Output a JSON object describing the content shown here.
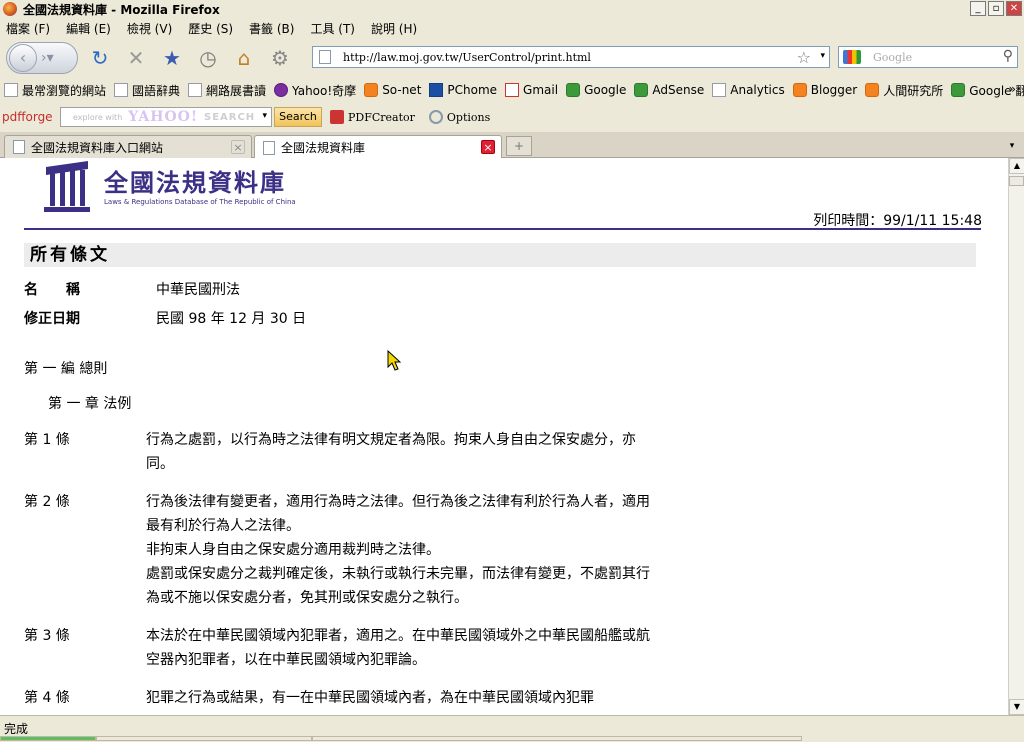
{
  "window": {
    "title": "全國法規資料庫 - Mozilla Firefox",
    "controls": [
      "_",
      "▫",
      "✕"
    ]
  },
  "menu": [
    "檔案 (F)",
    "編輯 (E)",
    "檢視 (V)",
    "歷史 (S)",
    "書籤 (B)",
    "工具 (T)",
    "說明 (H)"
  ],
  "nav": {
    "url": "http://law.moj.gov.tw/UserControl/print.html",
    "search_placeholder": "Google"
  },
  "bookmarks": [
    {
      "label": "最常瀏覽的網站",
      "icon": "page-icon"
    },
    {
      "label": "國語辭典",
      "icon": "page-icon"
    },
    {
      "label": "網路展書讀",
      "icon": "page-icon"
    },
    {
      "label": "Yahoo!奇摩",
      "icon": "yahoo-icon"
    },
    {
      "label": "So-net",
      "icon": "so-net-icon"
    },
    {
      "label": "PChome",
      "icon": "pchome-icon"
    },
    {
      "label": "Gmail",
      "icon": "gmail-icon"
    },
    {
      "label": "Google",
      "icon": "google-icon"
    },
    {
      "label": "AdSense",
      "icon": "google-icon"
    },
    {
      "label": "Analytics",
      "icon": "analytics-icon"
    },
    {
      "label": "Blogger",
      "icon": "blogger-icon"
    },
    {
      "label": "人間研究所",
      "icon": "blogger-icon"
    },
    {
      "label": "Google 翻譯",
      "icon": "google-icon"
    }
  ],
  "pdfforge": {
    "logo": "pdfforge",
    "search_placeholder": "explore with",
    "yahoo_logo": "YAHOO!",
    "yahoo_search": "SEARCH",
    "search_button": "Search",
    "pdfcreator": "PDFCreator",
    "options": "Options"
  },
  "tabs": [
    {
      "label": "全國法規資料庫入口網站",
      "active": false
    },
    {
      "label": "全國法規資料庫",
      "active": true
    }
  ],
  "page": {
    "logo_title": "全國法規資料庫",
    "logo_subtitle": "Laws & Regulations Database of The Republic of China",
    "print_time": "列印時間：99/1/11 15:48",
    "section_heading": "所有條文",
    "meta": [
      {
        "label": "名　　稱",
        "value": "中華民國刑法"
      },
      {
        "label": "修正日期",
        "value": "民國 98 年 12 月 30 日"
      }
    ],
    "part": "第 一 編 總則",
    "chapter": "第 一 章 法例",
    "articles": [
      {
        "num": "第 1 條",
        "paragraphs": [
          "行為之處罰，以行為時之法律有明文規定者為限。拘束人身自由之保安處分，亦同。"
        ]
      },
      {
        "num": "第 2 條",
        "paragraphs": [
          "行為後法律有變更者，適用行為時之法律。但行為後之法律有利於行為人者，適用最有利於行為人之法律。",
          "非拘束人身自由之保安處分適用裁判時之法律。",
          "處罰或保安處分之裁判確定後，未執行或執行未完畢，而法律有變更，不處罰其行為或不施以保安處分者，免其刑或保安處分之執行。"
        ]
      },
      {
        "num": "第 3 條",
        "paragraphs": [
          "本法於在中華民國領域內犯罪者，適用之。在中華民國領域外之中華民國船艦或航空器內犯罪者，以在中華民國領域內犯罪論。"
        ]
      },
      {
        "num": "第 4 條",
        "paragraphs": [
          "犯罪之行為或結果，有一在中華民國領域內者，為在中華民國領域內犯罪"
        ]
      }
    ]
  },
  "status": {
    "text": "完成"
  }
}
